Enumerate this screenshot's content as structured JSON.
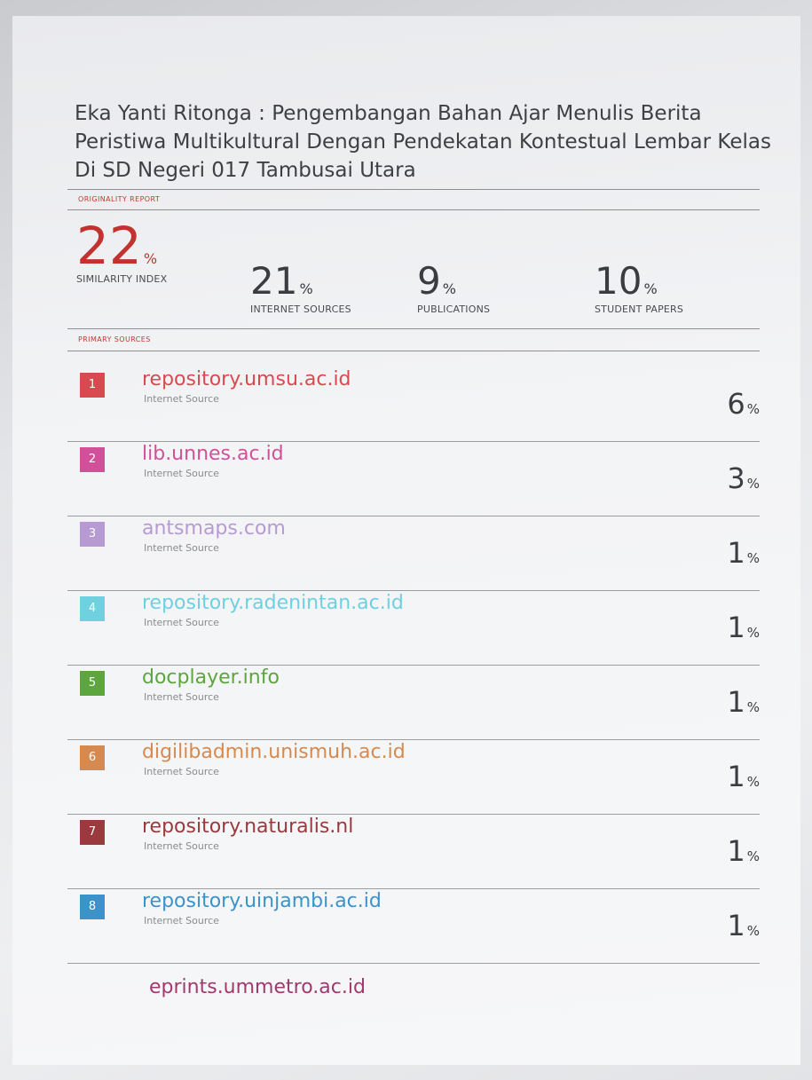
{
  "document": {
    "title": "Eka Yanti Ritonga : Pengembangan Bahan Ajar Menulis Berita Peristiwa Multikultural Dengan Pendekatan Kontestual Lembar Kelas Di SD Negeri 017 Tambusai Utara",
    "originality_report_label": "ORIGINALITY REPORT",
    "primary_sources_label": "PRIMARY SOURCES"
  },
  "stats": [
    {
      "value": "22",
      "unit": "%",
      "label": "SIMILARITY INDEX"
    },
    {
      "value": "21",
      "unit": "%",
      "label": "INTERNET SOURCES"
    },
    {
      "value": "9",
      "unit": "%",
      "label": "PUBLICATIONS"
    },
    {
      "value": "10",
      "unit": "%",
      "label": "STUDENT PAPERS"
    }
  ],
  "sources": [
    {
      "rank": "1",
      "name": "repository.umsu.ac.id",
      "type": "Internet Source",
      "value": "6",
      "unit": "%",
      "color": "#d94a50"
    },
    {
      "rank": "2",
      "name": "lib.unnes.ac.id",
      "type": "Internet Source",
      "value": "3",
      "unit": "%",
      "color": "#d2509a"
    },
    {
      "rank": "3",
      "name": "antsmaps.com",
      "type": "Internet Source",
      "value": "1",
      "unit": "%",
      "color": "#b79ad2"
    },
    {
      "rank": "4",
      "name": "repository.radenintan.ac.id",
      "type": "Internet Source",
      "value": "1",
      "unit": "%",
      "color": "#6fd0df"
    },
    {
      "rank": "5",
      "name": "docplayer.info",
      "type": "Internet Source",
      "value": "1",
      "unit": "%",
      "color": "#5da53e"
    },
    {
      "rank": "6",
      "name": "digilibadmin.unismuh.ac.id",
      "type": "Internet Source",
      "value": "1",
      "unit": "%",
      "color": "#d68a4f"
    },
    {
      "rank": "7",
      "name": "repository.naturalis.nl",
      "type": "Internet Source",
      "value": "1",
      "unit": "%",
      "color": "#9b3a3e"
    },
    {
      "rank": "8",
      "name": "repository.uinjambi.ac.id",
      "type": "Internet Source",
      "value": "1",
      "unit": "%",
      "color": "#3b93c9"
    }
  ],
  "last_source": {
    "name": "eprints.ummetro.ac.id"
  }
}
